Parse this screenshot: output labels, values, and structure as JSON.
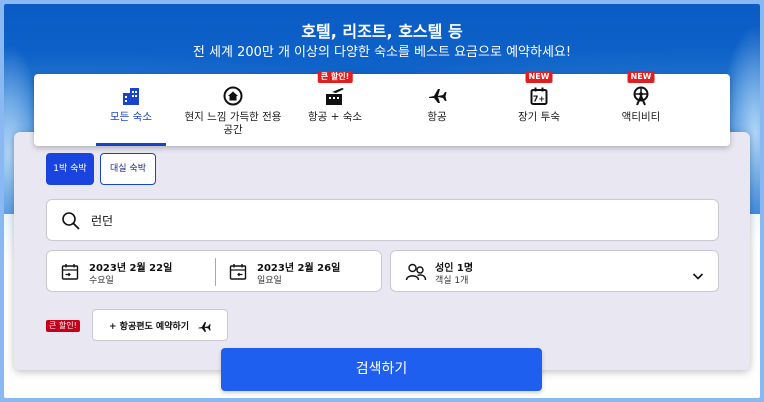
{
  "hero": {
    "title": "호텔, 리조트, 호스텔 등",
    "subtitle": "전 세계 200만 개 이상의 다양한 숙소를 베스트 요금으로 예약하세요!"
  },
  "tabs": [
    {
      "label": "모든 숙소",
      "icon": "hotel-building-icon",
      "badge": "",
      "active": true
    },
    {
      "label": "현지 느낌 가득한 전용 공간",
      "icon": "home-icon",
      "badge": "",
      "active": false
    },
    {
      "label": "항공 + 숙소",
      "icon": "flight-hotel-icon",
      "badge": "큰 할인!",
      "active": false
    },
    {
      "label": "항공",
      "icon": "airplane-icon",
      "badge": "",
      "active": false
    },
    {
      "label": "장기 투숙",
      "icon": "calendar-7-icon",
      "badge": "NEW",
      "active": false
    },
    {
      "label": "액티비티",
      "icon": "ferris-wheel-icon",
      "badge": "NEW",
      "active": false
    }
  ],
  "stay_type": {
    "overnight": "1박 숙박",
    "day_use": "대실 숙박"
  },
  "search": {
    "value": "런던"
  },
  "dates": {
    "checkin_date": "2023년 2월 22일",
    "checkin_day": "수요일",
    "checkout_date": "2023년 2월 26일",
    "checkout_day": "일요일"
  },
  "guests": {
    "main": "성인 1명",
    "sub": "객실 1개"
  },
  "promo_badge": "큰 할인!",
  "add_flight": "+ 항공편도 예약하기",
  "search_button": "검색하기",
  "colors": {
    "brand_blue": "#1a44e0",
    "badge_red": "#e02020",
    "button_blue": "#1f5ff0"
  }
}
